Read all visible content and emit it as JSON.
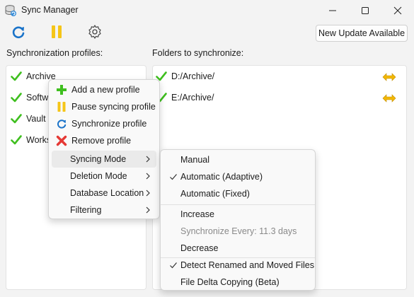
{
  "window": {
    "title": "Sync Manager"
  },
  "toolbar": {
    "update_button": "New Update Available"
  },
  "profiles": {
    "label": "Synchronization profiles:",
    "items": [
      {
        "label": "Archive",
        "checked": true
      },
      {
        "label": "Softw",
        "checked": true
      },
      {
        "label": "Vault",
        "checked": true
      },
      {
        "label": "Works",
        "checked": true
      }
    ]
  },
  "folders": {
    "label": "Folders to synchronize:",
    "items": [
      {
        "path": "D:/Archive/",
        "checked": true,
        "icon": "bidirectional-arrow-icon"
      },
      {
        "path": "E:/Archive/",
        "checked": true,
        "icon": "bidirectional-arrow-icon"
      }
    ]
  },
  "context_menu": {
    "items": [
      {
        "label": "Add a new profile",
        "icon": "plus-icon"
      },
      {
        "label": "Pause syncing profile",
        "icon": "pause-icon"
      },
      {
        "label": "Synchronize profile",
        "icon": "refresh-icon"
      },
      {
        "label": "Remove profile",
        "icon": "close-icon"
      },
      {
        "label": "Syncing Mode",
        "submenu": true
      },
      {
        "label": "Deletion Mode",
        "submenu": true
      },
      {
        "label": "Database Location",
        "submenu": true
      },
      {
        "label": "Filtering",
        "submenu": true
      }
    ]
  },
  "syncing_mode_menu": {
    "items": [
      {
        "label": "Manual",
        "checked": false,
        "disabled": false
      },
      {
        "label": "Automatic (Adaptive)",
        "checked": true,
        "disabled": false
      },
      {
        "label": "Automatic (Fixed)",
        "checked": false,
        "disabled": false
      },
      {
        "label": "Increase",
        "checked": false,
        "disabled": false
      },
      {
        "label": "Synchronize Every: 11.3 days",
        "checked": false,
        "disabled": true
      },
      {
        "label": "Decrease",
        "checked": false,
        "disabled": false
      },
      {
        "label": "Detect Renamed and Moved Files",
        "checked": true,
        "disabled": false
      },
      {
        "label": "File Delta Copying (Beta)",
        "checked": false,
        "disabled": false
      }
    ]
  },
  "colors": {
    "accent_blue": "#1a73c9",
    "check_green": "#3fbf1f",
    "pause_yellow": "#f5c518",
    "remove_red": "#e53935",
    "arrow_yellow": "#f2b705"
  }
}
